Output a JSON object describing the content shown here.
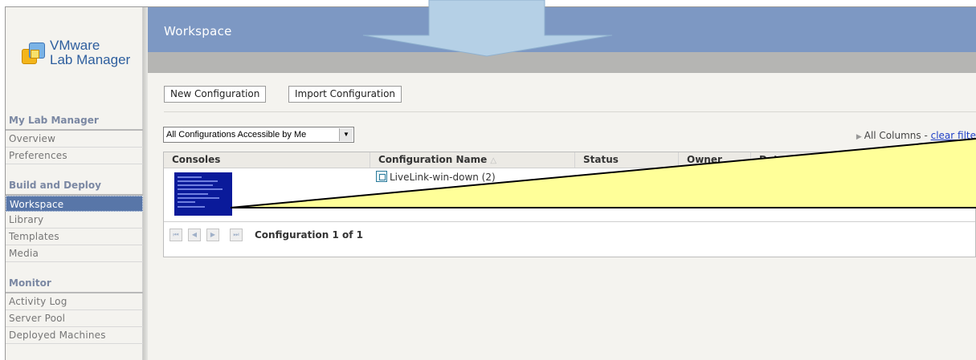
{
  "app": {
    "logo_line1": "VMware",
    "logo_line2": "Lab Manager"
  },
  "sidebar": {
    "sections": [
      {
        "heading": "My Lab Manager",
        "items": [
          "Overview",
          "Preferences"
        ]
      },
      {
        "heading": "Build and Deploy",
        "items": [
          "Workspace",
          "Library",
          "Templates",
          "Media"
        ]
      },
      {
        "heading": "Monitor",
        "items": [
          "Activity Log",
          "Server Pool",
          "Deployed Machines"
        ]
      }
    ],
    "active_item": "Workspace"
  },
  "header": {
    "title": "Workspace"
  },
  "toolbar": {
    "new_label": "New Configuration",
    "import_label": "Import Configuration"
  },
  "filter": {
    "selected": "All Configurations Accessible by Me",
    "columns_label": "All Columns - ",
    "clear_label": "clear filte"
  },
  "table": {
    "columns": [
      "Consoles",
      "Configuration Name",
      "Status",
      "Owner",
      "Date D"
    ],
    "sort_indicator": "△",
    "rows": [
      {
        "configuration_name": "LiveLink-win-down (2)"
      }
    ]
  },
  "pager": {
    "text": "Configuration 1 of 1"
  },
  "colors": {
    "banner": "#7d98c3",
    "active_nav": "#5876a8",
    "callout_fill": "#ffff99",
    "arrow_fill": "#b5d0e6"
  }
}
